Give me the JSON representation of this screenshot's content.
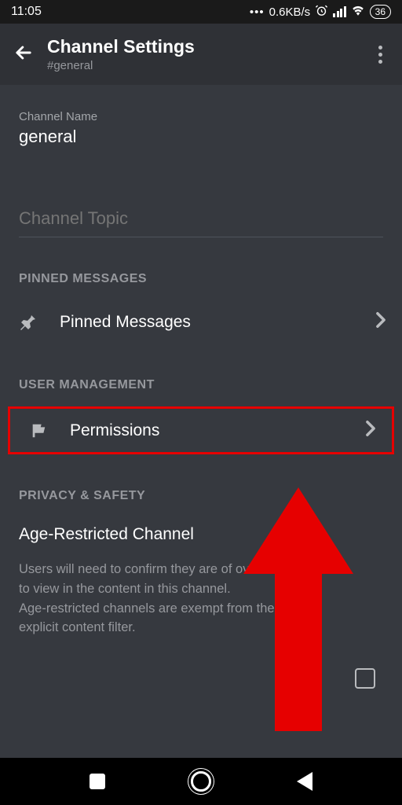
{
  "status": {
    "time": "11:05",
    "net_speed": "0.6KB/s",
    "battery": "36"
  },
  "header": {
    "title": "Channel Settings",
    "subtitle": "#general"
  },
  "channel": {
    "name_label": "Channel Name",
    "name_value": "general",
    "topic_placeholder": "Channel Topic"
  },
  "sections": {
    "pinned_header": "PINNED MESSAGES",
    "pinned_label": "Pinned Messages",
    "user_header": "USER MANAGEMENT",
    "permissions_label": "Permissions",
    "privacy_header": "PRIVACY & SAFETY"
  },
  "age": {
    "title": "Age-Restricted Channel",
    "desc": "Users will need to confirm they are of over legal age to view in the content in this channel.\nAge-restricted channels are exempt from the explicit content filter."
  }
}
